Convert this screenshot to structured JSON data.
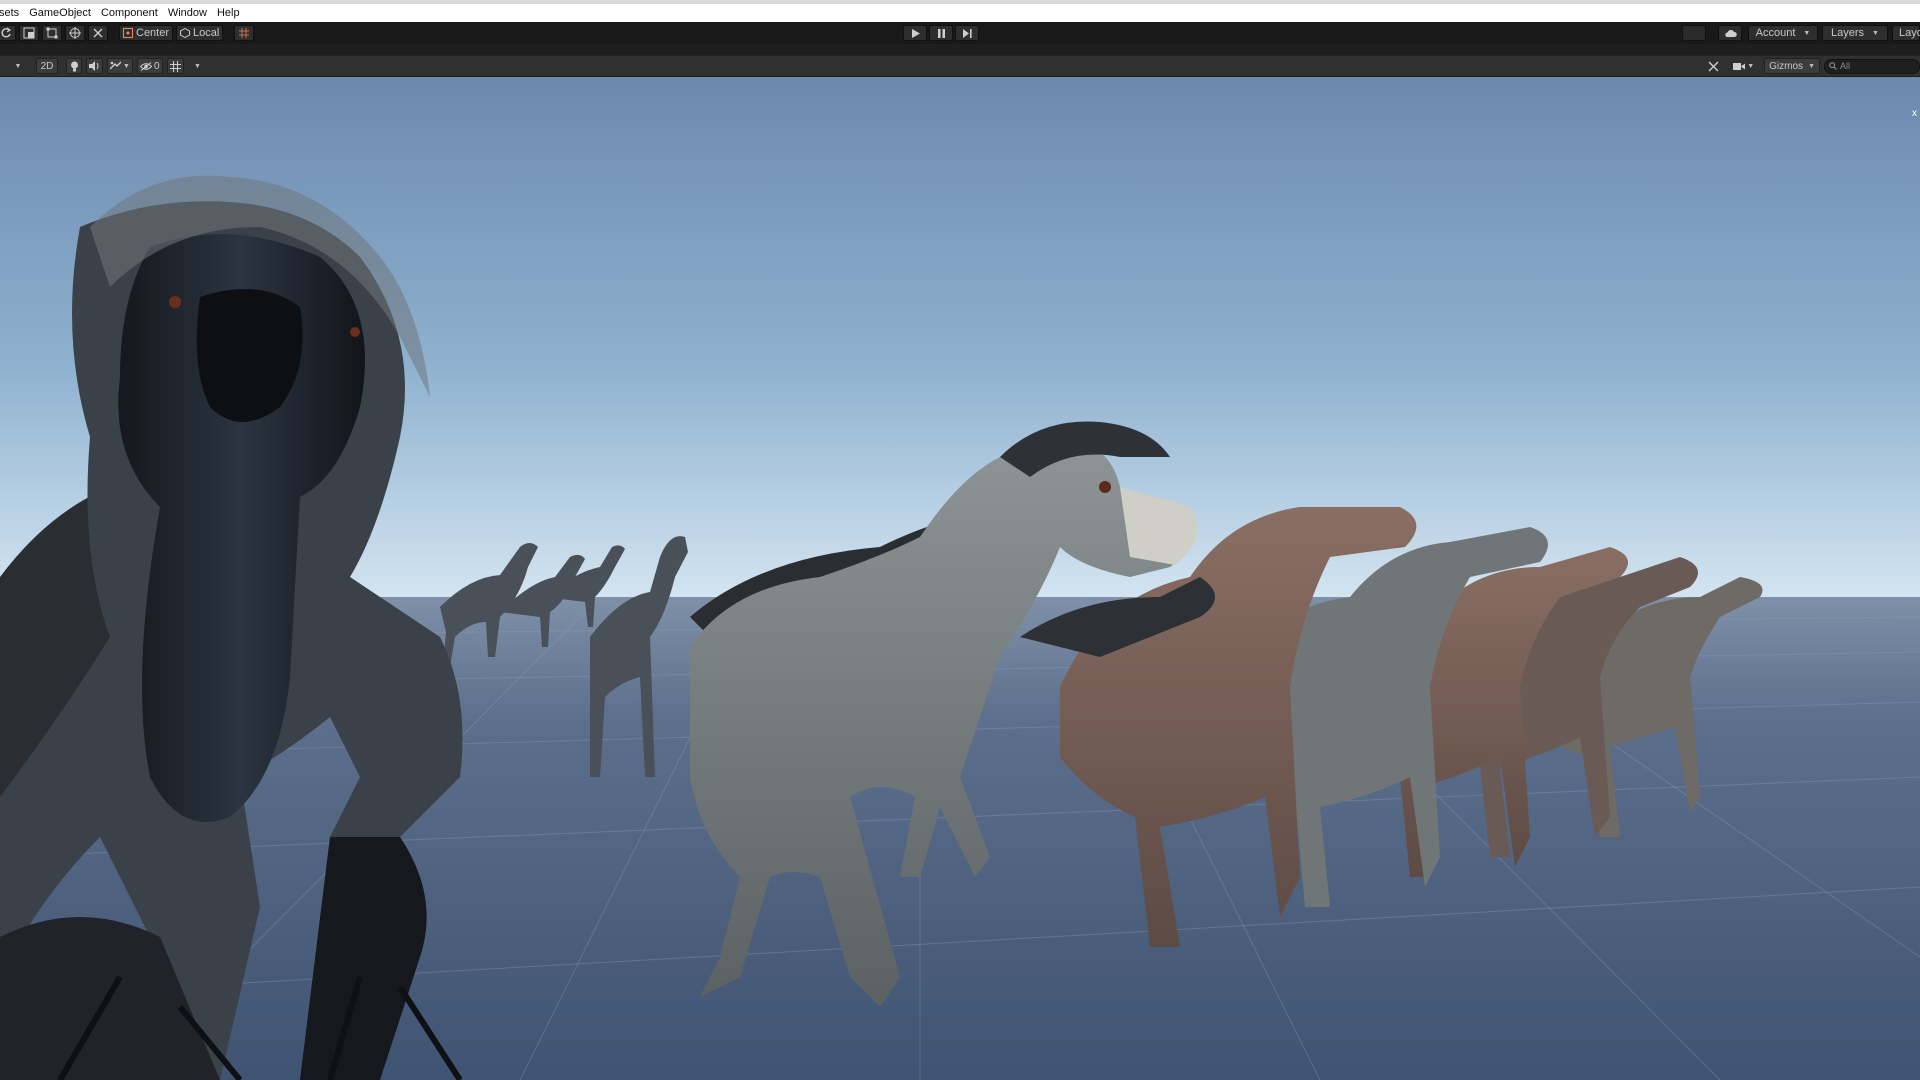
{
  "menubar": {
    "items": [
      "sets",
      "GameObject",
      "Component",
      "Window",
      "Help"
    ]
  },
  "toolbar": {
    "pivot_label": "Center",
    "space_label": "Local",
    "account_label": "Account",
    "layers_label": "Layers",
    "layout_label": "Layo"
  },
  "scene_toolbar": {
    "mode_2d_label": "2D",
    "hidden_count": "0",
    "gizmos_label": "Gizmos",
    "search_placeholder": "All"
  },
  "viewport": {
    "close_glyph": "x",
    "sky_top_color": "#6c89ad",
    "sky_horizon_color": "#d3e4f1",
    "ground_color": "#5c6f8c"
  }
}
